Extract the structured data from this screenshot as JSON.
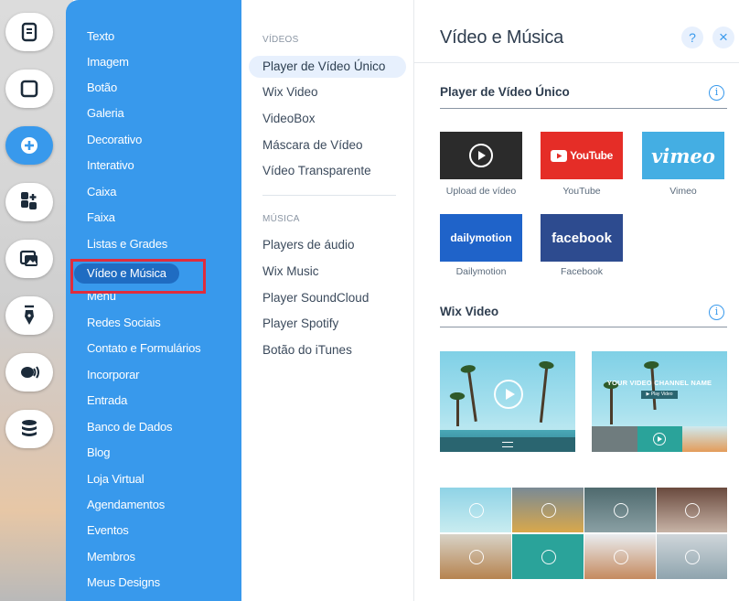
{
  "rail": {
    "items": [
      {
        "icon": "pages-icon"
      },
      {
        "icon": "background-icon"
      },
      {
        "icon": "add-icon",
        "active": true
      },
      {
        "icon": "app-market-icon"
      },
      {
        "icon": "media-icon"
      },
      {
        "icon": "blog-pen-icon"
      },
      {
        "icon": "chat-icon"
      },
      {
        "icon": "database-icon"
      }
    ]
  },
  "categories": [
    "Texto",
    "Imagem",
    "Botão",
    "Galeria",
    "Decorativo",
    "Interativo",
    "Caixa",
    "Faixa",
    "Listas e Grades",
    "Vídeo e Música",
    "Menu",
    "Redes Sociais",
    "Contato e Formulários",
    "Incorporar",
    "Entrada",
    "Banco de Dados",
    "Blog",
    "Loja Virtual",
    "Agendamentos",
    "Eventos",
    "Membros",
    "Meus Designs"
  ],
  "selected_category": "Vídeo e Música",
  "sublist": {
    "videos_header": "VÍDEOS",
    "videos": [
      "Player de Vídeo Único",
      "Wix Video",
      "VideoBox",
      "Máscara de Vídeo",
      "Vídeo Transparente"
    ],
    "music_header": "MÚSICA",
    "music": [
      "Players de áudio",
      "Wix Music",
      "Player SoundCloud",
      "Player Spotify",
      "Botão do iTunes"
    ]
  },
  "panel": {
    "title": "Vídeo e Música",
    "help_label": "?",
    "close_label": "×",
    "section1_title": "Player de Vídeo Único",
    "section2_title": "Wix Video",
    "info_label": "i",
    "tiles": [
      {
        "label": "Upload de vídeo",
        "text": "",
        "color": "#2b2b2b"
      },
      {
        "label": "YouTube",
        "text": "YouTube",
        "color": "#e52d27"
      },
      {
        "label": "Vimeo",
        "text": "vimeo",
        "color": "#44aee3"
      },
      {
        "label": "Dailymotion",
        "text": "dailymotion",
        "color": "#1f63c9"
      },
      {
        "label": "Facebook",
        "text": "facebook",
        "color": "#2d4b8f"
      }
    ],
    "channel_text": "YOUR VIDEO CHANNEL NAME",
    "play_video_text": "▶ Play Video"
  },
  "colors": {
    "accent": "#3899ec",
    "selected_pill": "#1f6cc2",
    "highlight": "#e02d3c"
  }
}
